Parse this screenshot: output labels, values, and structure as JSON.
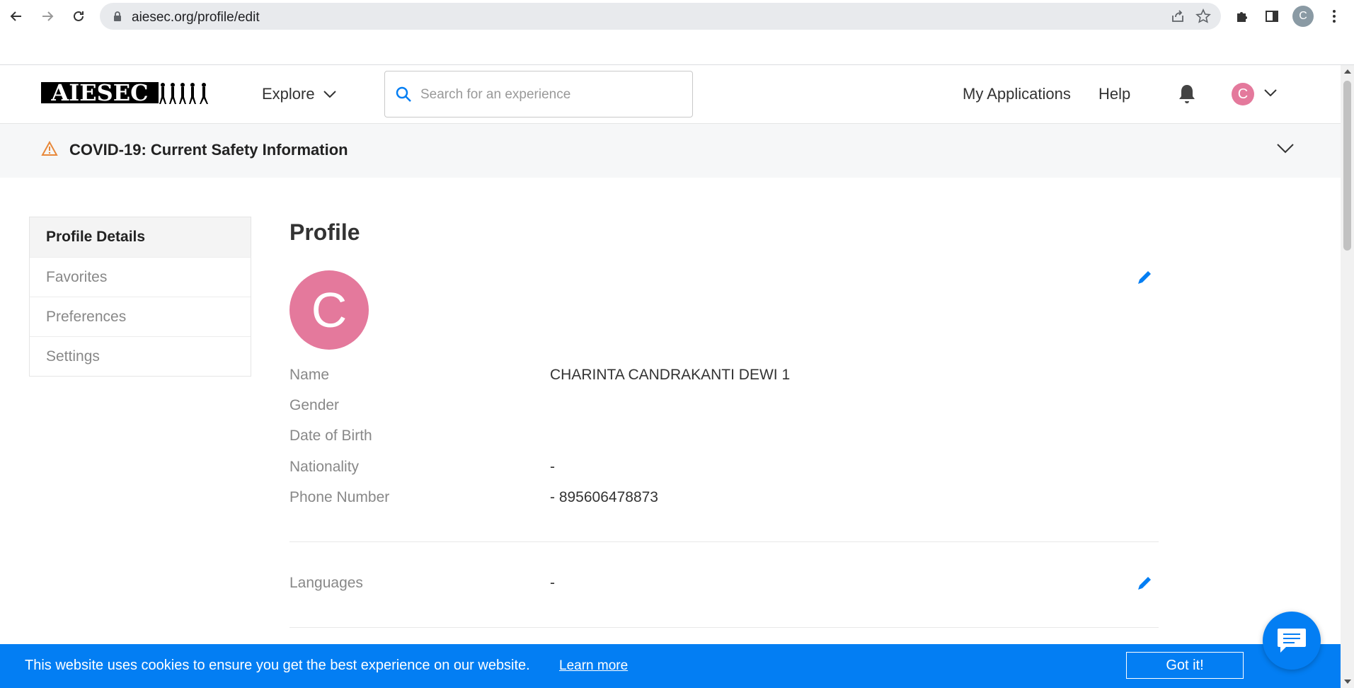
{
  "browser": {
    "url": "aiesec.org/profile/edit",
    "profile_initial": "C"
  },
  "header": {
    "logo_text": "AIESEC",
    "explore_label": "Explore",
    "search_placeholder": "Search for an experience",
    "my_applications": "My Applications",
    "help": "Help",
    "avatar_initial": "C"
  },
  "covid": {
    "text": "COVID-19: Current Safety Information"
  },
  "sidebar": {
    "items": [
      {
        "label": "Profile Details"
      },
      {
        "label": "Favorites"
      },
      {
        "label": "Preferences"
      },
      {
        "label": "Settings"
      }
    ]
  },
  "profile": {
    "title": "Profile",
    "avatar_initial": "C",
    "fields": [
      {
        "label": "Name",
        "value": "CHARINTA CANDRAKANTI DEWI 1"
      },
      {
        "label": "Gender",
        "value": ""
      },
      {
        "label": "Date of Birth",
        "value": ""
      },
      {
        "label": "Nationality",
        "value": "-"
      },
      {
        "label": "Phone Number",
        "value": "- 895606478873"
      }
    ],
    "languages": {
      "label": "Languages",
      "value": "-"
    }
  },
  "cookie": {
    "message": "This website uses cookies to ensure you get the best experience on our website.",
    "learn_more": "Learn more",
    "accept": "Got it!"
  },
  "colors": {
    "brand_blue": "#037ef3",
    "avatar_pink": "#e4799c",
    "warning_orange": "#e8883a"
  }
}
